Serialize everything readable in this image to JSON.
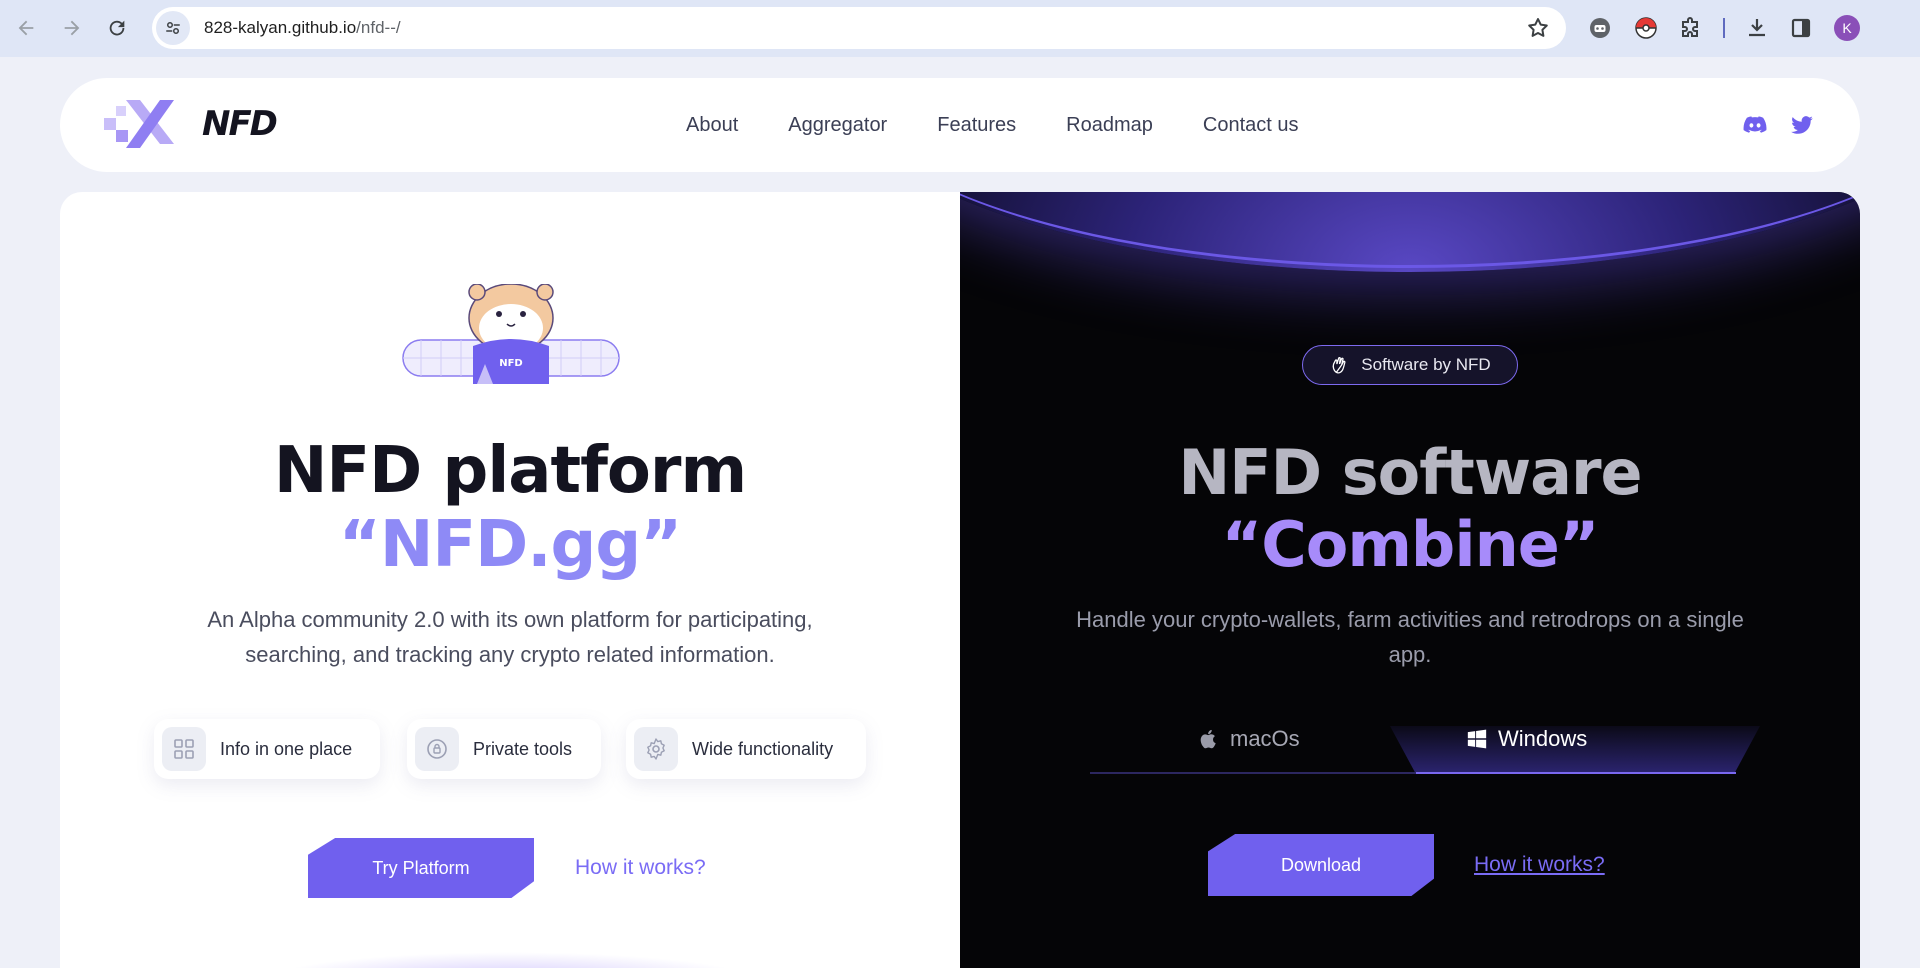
{
  "browser": {
    "url_host": "828-kalyan.github.io",
    "url_path": "/nfd--/",
    "profile_initial": "K",
    "icons": [
      "back-icon",
      "forward-icon",
      "reload-icon",
      "site-settings-icon",
      "bookmark-star-icon",
      "robot-extension-icon",
      "pokeball-extension-icon",
      "extensions-icon",
      "downloads-icon",
      "side-panel-icon"
    ]
  },
  "header": {
    "logo_text": "NFD",
    "nav": [
      "About",
      "Aggregator",
      "Features",
      "Roadmap",
      "Contact us"
    ],
    "social": [
      "discord-icon",
      "twitter-icon"
    ]
  },
  "left": {
    "title": "NFD platform",
    "subtitle": "“NFD.gg”",
    "description": "An Alpha community 2.0 with its own platform for participating, searching, and tracking any crypto related information.",
    "features": [
      {
        "label": "Info in one place",
        "icon": "grid-icon"
      },
      {
        "label": "Private tools",
        "icon": "lock-icon"
      },
      {
        "label": "Wide functionality",
        "icon": "gear-icon"
      }
    ],
    "cta": "Try Platform",
    "link": "How it works?"
  },
  "right": {
    "badge": "Software by NFD",
    "title": "NFD software",
    "subtitle": "“Combine”",
    "description": "Handle your crypto-wallets, farm activities and retrodrops on a single app.",
    "os_tabs": [
      {
        "label": "macOs",
        "icon": "apple-icon",
        "active": false
      },
      {
        "label": "Windows",
        "icon": "windows-icon",
        "active": true
      }
    ],
    "cta": "Download",
    "link": "How it works?"
  },
  "colors": {
    "accent": "#7060ee",
    "accent_light": "#8e8af6",
    "dark_bg": "#050507"
  }
}
